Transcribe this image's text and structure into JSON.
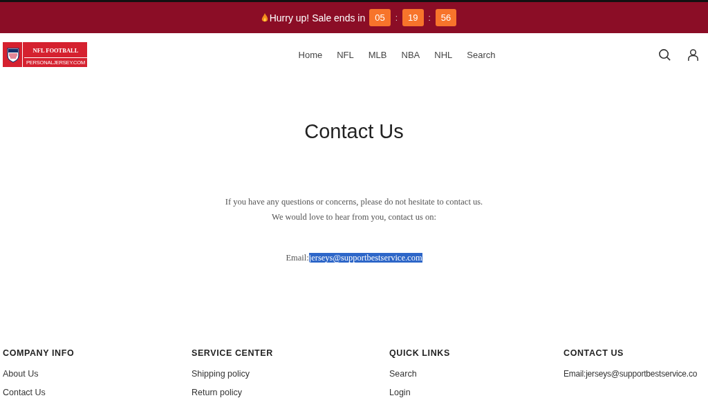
{
  "announcement": {
    "text": "Hurry up! Sale ends in",
    "timer": [
      "05",
      "19",
      "56"
    ],
    "separator": ":"
  },
  "logo": {
    "title": "NFL FOOTBALL",
    "subtitle": "PERSONALJERSEY.COM"
  },
  "nav": [
    "Home",
    "NFL",
    "MLB",
    "NBA",
    "NHL",
    "Search"
  ],
  "page": {
    "title": "Contact Us",
    "lines": [
      "If you have any questions or concerns, please do not hesitate to contact us.",
      "We would love to hear from you, contact us on:"
    ],
    "email_label": "Email:",
    "email": "jerseys@supportbestservice.com",
    "email_selected": true
  },
  "footer": [
    {
      "heading": "COMPANY INFO",
      "links": [
        "About Us",
        "Contact Us"
      ]
    },
    {
      "heading": "SERVICE CENTER",
      "links": [
        "Shipping policy",
        "Return policy"
      ]
    },
    {
      "heading": "QUICK LINKS",
      "links": [
        "Search",
        "Login"
      ]
    },
    {
      "heading": "CONTACT US",
      "links": [
        "Email:jerseys@supportbestservice.co"
      ]
    }
  ]
}
